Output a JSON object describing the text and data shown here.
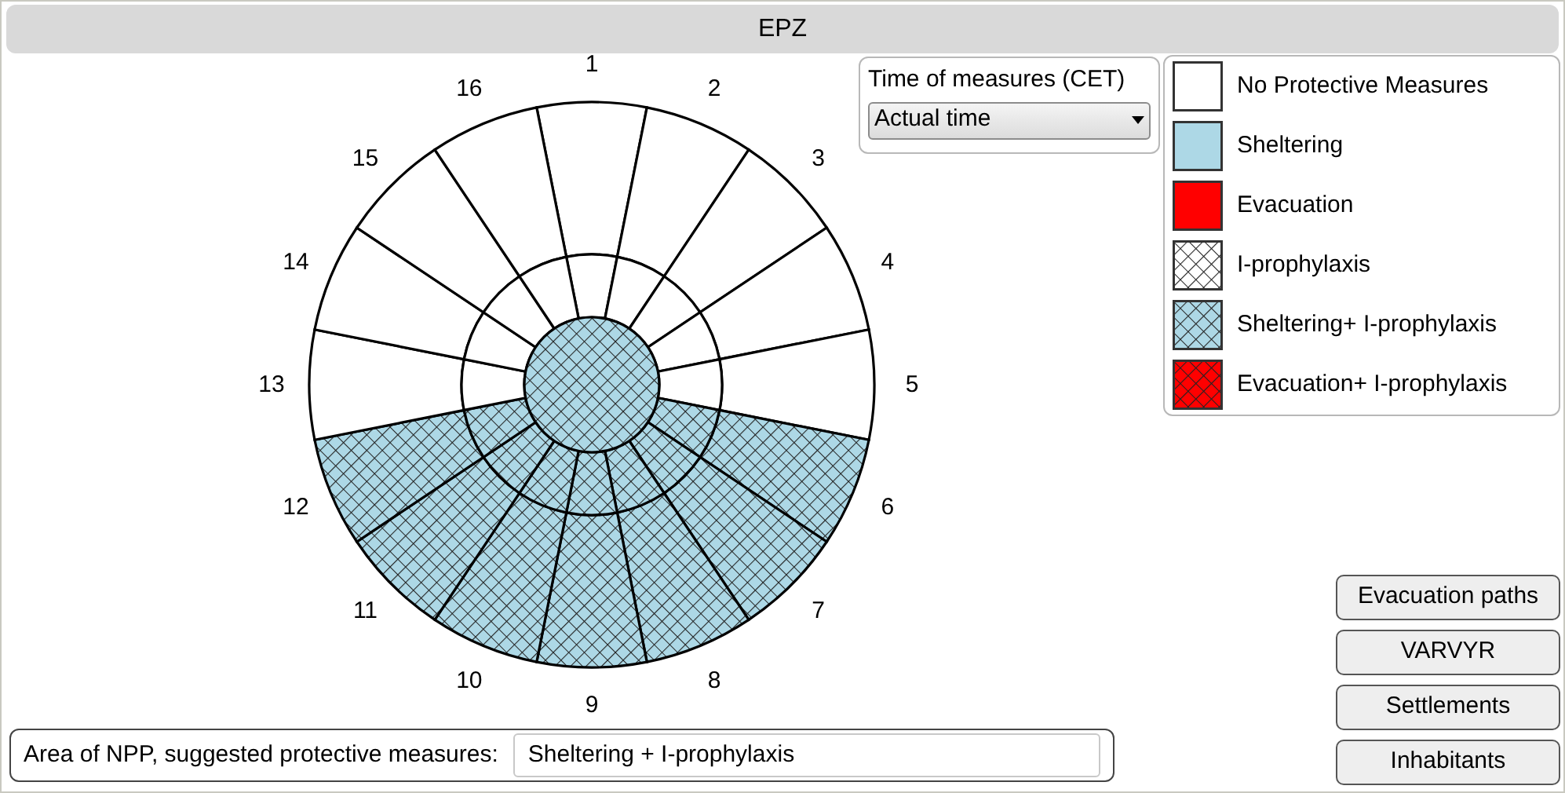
{
  "title": "EPZ",
  "diagram": {
    "center": {
      "kind": "sheltering_iodine"
    },
    "sectors": [
      {
        "label": "1",
        "inner": {
          "kind": "none"
        },
        "outer": {
          "kind": "none"
        }
      },
      {
        "label": "2",
        "inner": {
          "kind": "none"
        },
        "outer": {
          "kind": "none"
        }
      },
      {
        "label": "3",
        "inner": {
          "kind": "none"
        },
        "outer": {
          "kind": "none"
        }
      },
      {
        "label": "4",
        "inner": {
          "kind": "none"
        },
        "outer": {
          "kind": "none"
        }
      },
      {
        "label": "5",
        "inner": {
          "kind": "none"
        },
        "outer": {
          "kind": "none"
        }
      },
      {
        "label": "6",
        "inner": {
          "kind": "sheltering_iodine"
        },
        "outer": {
          "kind": "sheltering_iodine"
        }
      },
      {
        "label": "7",
        "inner": {
          "kind": "sheltering_iodine"
        },
        "outer": {
          "kind": "sheltering_iodine"
        }
      },
      {
        "label": "8",
        "inner": {
          "kind": "sheltering_iodine"
        },
        "outer": {
          "kind": "sheltering_iodine"
        }
      },
      {
        "label": "9",
        "inner": {
          "kind": "sheltering_iodine"
        },
        "outer": {
          "kind": "sheltering_iodine"
        }
      },
      {
        "label": "10",
        "inner": {
          "kind": "sheltering_iodine"
        },
        "outer": {
          "kind": "sheltering_iodine"
        }
      },
      {
        "label": "11",
        "inner": {
          "kind": "sheltering_iodine"
        },
        "outer": {
          "kind": "sheltering_iodine"
        }
      },
      {
        "label": "12",
        "inner": {
          "kind": "sheltering_iodine"
        },
        "outer": {
          "kind": "sheltering_iodine"
        }
      },
      {
        "label": "13",
        "inner": {
          "kind": "none"
        },
        "outer": {
          "kind": "none"
        }
      },
      {
        "label": "14",
        "inner": {
          "kind": "none"
        },
        "outer": {
          "kind": "none"
        }
      },
      {
        "label": "15",
        "inner": {
          "kind": "none"
        },
        "outer": {
          "kind": "none"
        }
      },
      {
        "label": "16",
        "inner": {
          "kind": "none"
        },
        "outer": {
          "kind": "none"
        }
      }
    ]
  },
  "time_of_measures": {
    "label": "Time of measures (CET)",
    "value": "Actual time"
  },
  "legend": [
    {
      "kind": "none",
      "label": "No Protective Measures"
    },
    {
      "kind": "sheltering",
      "label": "Sheltering"
    },
    {
      "kind": "evacuation",
      "label": "Evacuation"
    },
    {
      "kind": "iodine",
      "label": "I-prophylaxis"
    },
    {
      "kind": "sheltering_iodine",
      "label": "Sheltering+ I-prophylaxis"
    },
    {
      "kind": "evacuation_iodine",
      "label": "Evacuation+ I-prophylaxis"
    }
  ],
  "suggested": {
    "label": "Area of NPP, suggested protective measures:",
    "value": "Sheltering + I-prophylaxis"
  },
  "buttons": [
    "Evacuation paths",
    "VARVYR",
    "Settlements",
    "Inhabitants"
  ]
}
